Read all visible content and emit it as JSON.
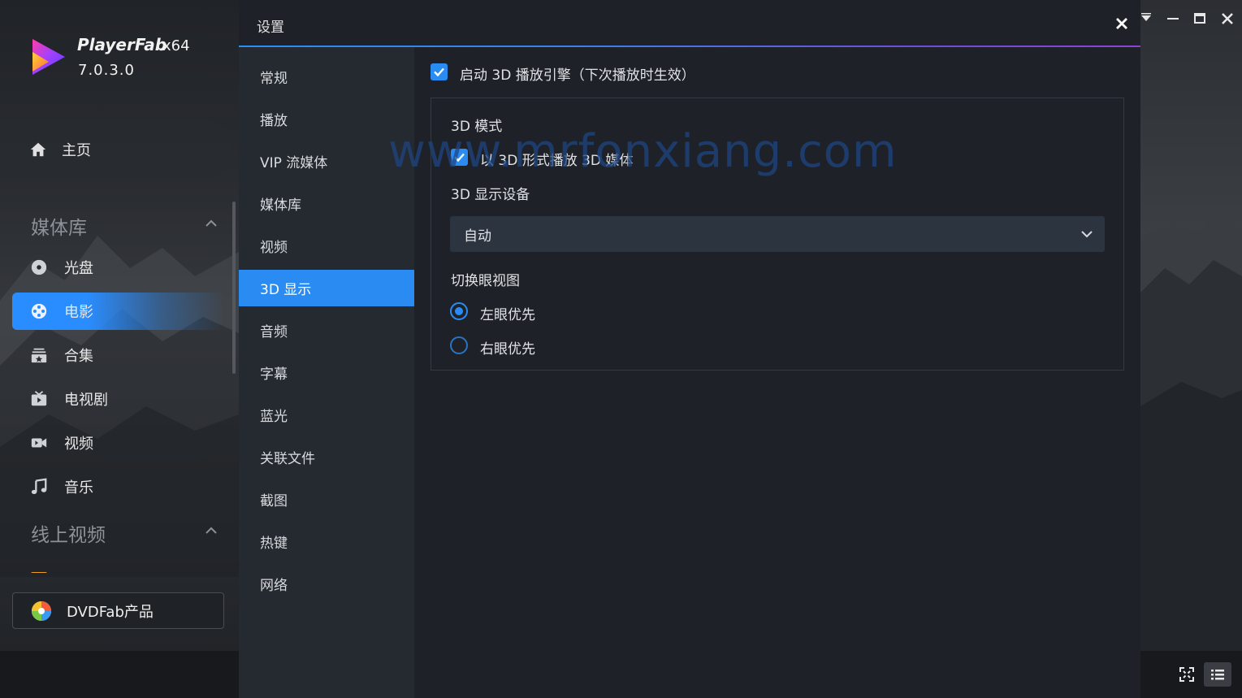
{
  "app": {
    "brand": "PlayerFab",
    "arch": "x64",
    "version": "7.0.3.0"
  },
  "sidebar": {
    "home_label": "主页",
    "section_media": "媒体库",
    "items": [
      {
        "label": "光盘",
        "icon": "disc-icon"
      },
      {
        "label": "电影",
        "icon": "film-reel-icon"
      },
      {
        "label": "合集",
        "icon": "collection-icon"
      },
      {
        "label": "电视剧",
        "icon": "tv-icon"
      },
      {
        "label": "视频",
        "icon": "video-camera-icon"
      },
      {
        "label": "音乐",
        "icon": "music-note-icon"
      }
    ],
    "active_index": 1,
    "section_online": "线上视频",
    "dvdfab_label": "DVDFab产品"
  },
  "dialog": {
    "title": "设置",
    "nav": [
      "常规",
      "播放",
      "VIP 流媒体",
      "媒体库",
      "视频",
      "3D 显示",
      "音频",
      "字幕",
      "蓝光",
      "关联文件",
      "截图",
      "热键",
      "网络"
    ],
    "active_nav": "3D 显示"
  },
  "settings3d": {
    "enable_label": "启动 3D 播放引擎（下次播放时生效）",
    "enable_checked": true,
    "mode_title": "3D 模式",
    "mode_checkbox_label": "以 3D 形式播放 3D 媒体",
    "mode_checked": true,
    "device_title": "3D 显示设备",
    "device_value": "自动",
    "eye_title": "切换眼视图",
    "left_eye_label": "左眼优先",
    "right_eye_label": "右眼优先",
    "eye_selected": "左眼优先"
  },
  "watermark": "www.mrfonxiang.com",
  "colors": {
    "accent": "#2a8cf2",
    "dialog_bg": "#1e2228",
    "nav_bg": "#252a31"
  }
}
